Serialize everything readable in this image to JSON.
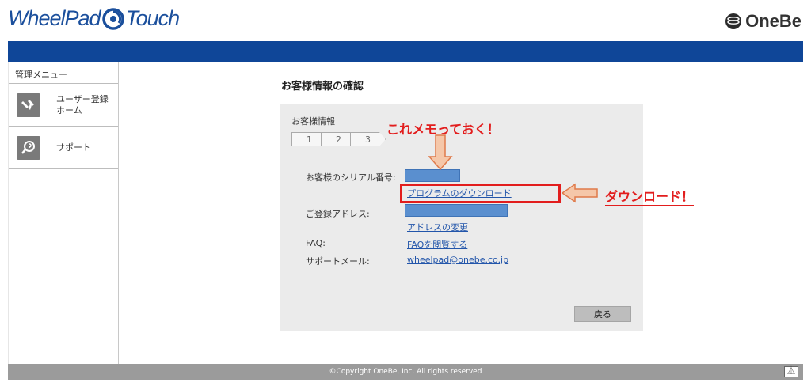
{
  "header": {
    "logo_left": "WheelPad",
    "logo_right": "Touch",
    "brand": "OneBe"
  },
  "sidebar": {
    "heading": "管理メニュー",
    "items": [
      {
        "label_line1": "ユーザー登録",
        "label_line2": "ホーム",
        "icon": "tools-icon"
      },
      {
        "label_line1": "サポート",
        "label_line2": "",
        "icon": "support-icon"
      }
    ]
  },
  "main": {
    "page_title": "お客様情報の確認",
    "panel": {
      "title": "お客様情報",
      "steps": [
        "1",
        "2",
        "3"
      ],
      "serial_label": "お客様のシリアル番号:",
      "download_link": "プログラムのダウンロード",
      "email_label": "ご登録アドレス:",
      "change_address_link": "アドレスの変更",
      "faq_label": "FAQ:",
      "faq_link": "FAQを閲覧する",
      "support_mail_label": "サポートメール:",
      "support_mail_link": "wheelpad@onebe.co.jp",
      "back_button": "戻る"
    }
  },
  "annotations": {
    "memo": "これメモっておく！",
    "download": "ダウンロード！"
  },
  "footer": {
    "copyright": "©Copyright OneBe, Inc. All rights reserved",
    "to_top": "⏅"
  },
  "colors": {
    "topbar": "#0f4698",
    "accent_red": "#e21d1d",
    "link": "#2255aa",
    "highlight_box": "#5a8fcf",
    "arrow_fill": "#f5c7a9"
  }
}
